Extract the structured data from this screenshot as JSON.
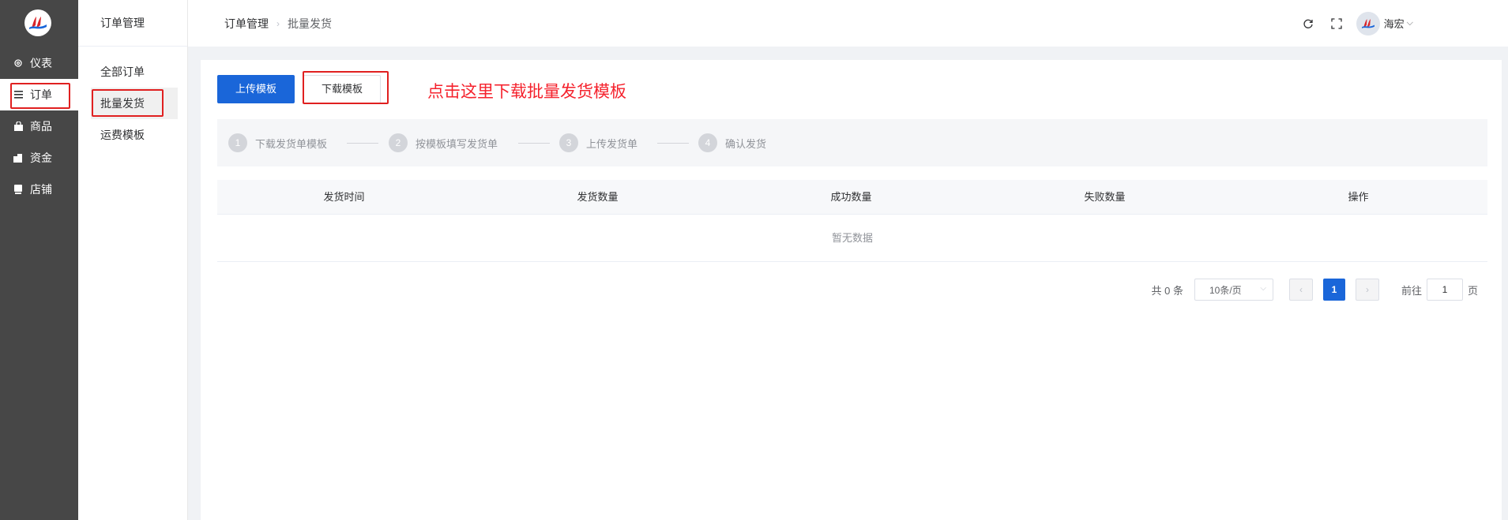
{
  "sidebar": {
    "items": [
      {
        "label": "仪表",
        "icon": "gear-icon"
      },
      {
        "label": "订单",
        "icon": "list-icon"
      },
      {
        "label": "商品",
        "icon": "bag-icon"
      },
      {
        "label": "资金",
        "icon": "wallet-icon"
      },
      {
        "label": "店铺",
        "icon": "store-icon"
      }
    ]
  },
  "subnav": {
    "title": "订单管理",
    "items": [
      {
        "label": "全部订单"
      },
      {
        "label": "批量发货"
      },
      {
        "label": "运费模板"
      }
    ]
  },
  "header": {
    "breadcrumb": [
      "订单管理",
      "批量发货"
    ],
    "user_name": "海宏"
  },
  "toolbar": {
    "upload_label": "上传模板",
    "download_label": "下载模板",
    "callout": "点击这里下载批量发货模板"
  },
  "steps": [
    {
      "num": "1",
      "label": "下载发货单模板"
    },
    {
      "num": "2",
      "label": "按模板填写发货单"
    },
    {
      "num": "3",
      "label": "上传发货单"
    },
    {
      "num": "4",
      "label": "确认发货"
    }
  ],
  "table": {
    "columns": [
      "发货时间",
      "发货数量",
      "成功数量",
      "失败数量",
      "操作"
    ],
    "empty_text": "暂无数据"
  },
  "pagination": {
    "total_text": "共 0 条",
    "page_size": "10条/页",
    "current_page": "1",
    "goto_label": "前往",
    "goto_value": "1",
    "page_unit": "页"
  },
  "colors": {
    "primary": "#1a66d9",
    "sidebar_bg": "#474747",
    "highlight": "#e02020",
    "callout": "#f5222d"
  }
}
